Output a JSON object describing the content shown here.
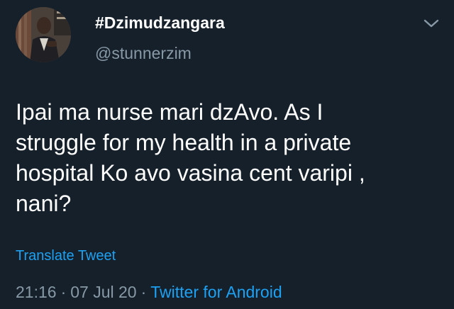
{
  "tweet": {
    "display_name": "#Dzimudzangara",
    "handle": "@stunnerzim",
    "text_lines": [
      "Ipai ma nurse mari dzAvo. As I",
      "struggle for my health in a private",
      "hospital Ko avo vasina cent varipi ,",
      "nani?"
    ],
    "translate_label": "Translate Tweet",
    "time": "21:16",
    "date": "07 Jul 20",
    "source": "Twitter for Android",
    "separator": "·"
  },
  "icons": {
    "menu": "chevron-down-icon",
    "avatar": "profile-photo"
  },
  "colors": {
    "background": "#15202b",
    "primary_text": "#ffffff",
    "secondary_text": "#8899a6",
    "link": "#1da1f2"
  }
}
